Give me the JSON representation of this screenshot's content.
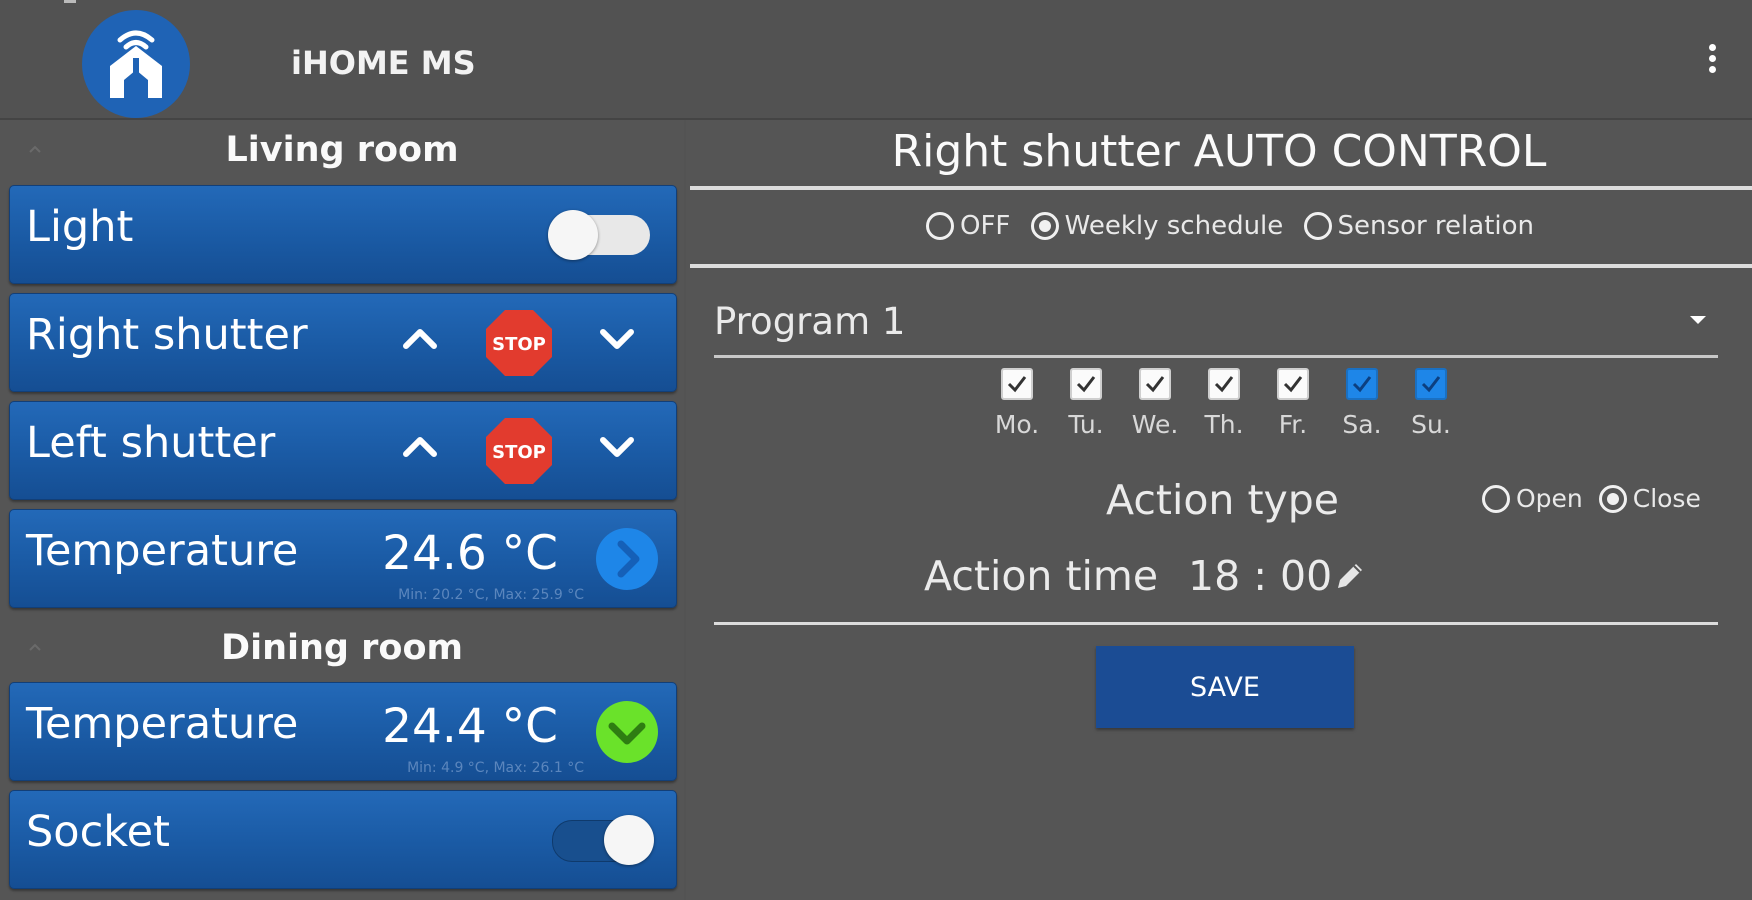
{
  "app": {
    "title": "iHOME MS",
    "logo_icon": "home-wifi-icon",
    "menu_icon": "more-vertical-icon"
  },
  "rooms": [
    {
      "name": "Living room",
      "devices": [
        {
          "type": "switch",
          "label": "Light",
          "state": "off"
        },
        {
          "type": "shutter",
          "label": "Right shutter",
          "stop_label": "STOP"
        },
        {
          "type": "shutter",
          "label": "Left shutter",
          "stop_label": "STOP"
        },
        {
          "type": "temperature",
          "label": "Temperature",
          "value": "24.6 °C",
          "minmax": "Min: 20.2 °C, Max: 25.9 °C",
          "trend_icon": "chevron-right-icon",
          "trend_color": "#1e86e8"
        }
      ]
    },
    {
      "name": "Dining room",
      "devices": [
        {
          "type": "temperature",
          "label": "Temperature",
          "value": "24.4 °C",
          "minmax": "Min: 4.9 °C, Max: 26.1 °C",
          "trend_icon": "chevron-down-icon",
          "trend_color": "#6ae22a"
        },
        {
          "type": "switch",
          "label": "Socket",
          "state": "on"
        }
      ]
    }
  ],
  "auto_control": {
    "title": "Right shutter AUTO CONTROL",
    "modes": [
      {
        "label": "OFF",
        "selected": false
      },
      {
        "label": "Weekly schedule",
        "selected": true
      },
      {
        "label": "Sensor relation",
        "selected": false
      }
    ],
    "program": "Program 1",
    "days": [
      {
        "label": "Mo.",
        "checked": true,
        "style": "white"
      },
      {
        "label": "Tu.",
        "checked": true,
        "style": "white"
      },
      {
        "label": "We.",
        "checked": true,
        "style": "white"
      },
      {
        "label": "Th.",
        "checked": true,
        "style": "white"
      },
      {
        "label": "Fr.",
        "checked": true,
        "style": "white"
      },
      {
        "label": "Sa.",
        "checked": true,
        "style": "blue"
      },
      {
        "label": "Su.",
        "checked": true,
        "style": "blue"
      }
    ],
    "action_type_label": "Action type",
    "action_types": [
      {
        "label": "Open",
        "selected": false
      },
      {
        "label": "Close",
        "selected": true
      }
    ],
    "action_time_label": "Action time",
    "action_time": "18 : 00",
    "save_label": "SAVE"
  },
  "colors": {
    "accent": "#1b4c94",
    "card": "#1a5aa4",
    "stop": "#e23b2e",
    "background": "#535353"
  }
}
